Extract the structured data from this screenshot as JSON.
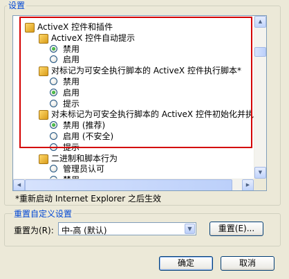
{
  "settings_group": {
    "title": "设置"
  },
  "tree": {
    "items": [
      {
        "kind": "folder",
        "label": "ActiveX 控件和插件"
      },
      {
        "kind": "folder",
        "label": "ActiveX 控件自动提示"
      },
      {
        "kind": "radio",
        "label": "禁用",
        "checked": true
      },
      {
        "kind": "radio",
        "label": "启用",
        "checked": false
      },
      {
        "kind": "folder",
        "label": "对标记为可安全执行脚本的 ActiveX 控件执行脚本*"
      },
      {
        "kind": "radio",
        "label": "禁用",
        "checked": false
      },
      {
        "kind": "radio",
        "label": "启用",
        "checked": true
      },
      {
        "kind": "radio",
        "label": "提示",
        "checked": false
      },
      {
        "kind": "folder",
        "label": "对未标记为可安全执行脚本的 ActiveX 控件初始化并执"
      },
      {
        "kind": "radio",
        "label": "禁用 (推荐)",
        "checked": true
      },
      {
        "kind": "radio",
        "label": "启用 (不安全)",
        "checked": false
      },
      {
        "kind": "radio",
        "label": "提示",
        "checked": false
      },
      {
        "kind": "folder",
        "label": "二进制和脚本行为"
      },
      {
        "kind": "radio",
        "label": "管理员认可",
        "checked": false
      },
      {
        "kind": "radio",
        "label": "禁用",
        "checked": false
      }
    ]
  },
  "restart_note": "*重新启动 Internet Explorer 之后生效",
  "reset_group": {
    "title": "重置自定义设置",
    "reset_to_label": "重置为(R):",
    "level_value": "中-高 (默认)",
    "reset_button": "重置(E)..."
  },
  "footer": {
    "ok_button": "确定",
    "cancel_button": "取消"
  },
  "colors": {
    "accent": "#0046d5",
    "highlight_border": "#d40000",
    "dialog_bg": "#ece9d8"
  }
}
